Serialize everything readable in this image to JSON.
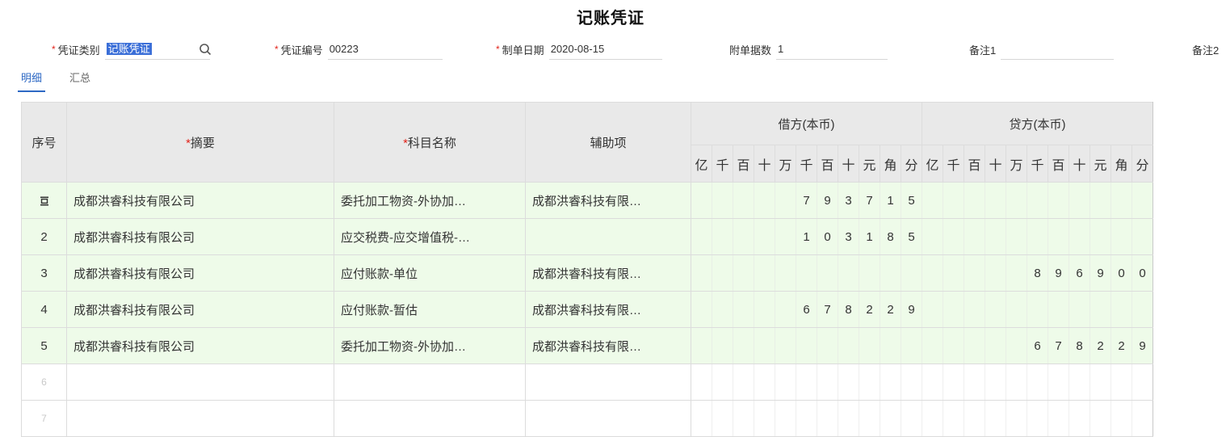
{
  "title": "记账凭证",
  "form": {
    "voucher_type": {
      "label": "凭证类别",
      "value": "记账凭证"
    },
    "voucher_no": {
      "label": "凭证编号",
      "value": "00223"
    },
    "date": {
      "label": "制单日期",
      "value": "2020-08-15"
    },
    "attachments": {
      "label": "附单据数",
      "value": "1"
    },
    "remark1": {
      "label": "备注1",
      "value": ""
    },
    "remark2": {
      "label": "备注2"
    }
  },
  "tabs": [
    {
      "label": "明细",
      "active": true
    },
    {
      "label": "汇总",
      "active": false
    }
  ],
  "table": {
    "headers": {
      "seq": "序号",
      "summary": "摘要",
      "account": "科目名称",
      "aux": "辅助项",
      "debit": "借方(本币)",
      "credit": "贷方(本币)"
    },
    "debit_digits": [
      "亿",
      "千",
      "百",
      "十",
      "万",
      "千",
      "百",
      "十",
      "元",
      "角",
      "分"
    ],
    "credit_digits": [
      "亿",
      "千",
      "百",
      "十",
      "万",
      "千",
      "百",
      "十",
      "元",
      "角",
      "分"
    ],
    "rows": [
      {
        "seq": "",
        "summary": "成都洪睿科技有限公司",
        "account": "委托加工物资-外协加…",
        "aux": "成都洪睿科技有限…",
        "debit": [
          "",
          "",
          "",
          "",
          "",
          "7",
          "9",
          "3",
          "7",
          "1",
          "5"
        ],
        "credit": [
          "",
          "",
          "",
          "",
          "",
          "",
          "",
          "",
          "",
          "",
          ""
        ]
      },
      {
        "seq": "2",
        "summary": "成都洪睿科技有限公司",
        "account": "应交税费-应交增值税-…",
        "aux": "",
        "debit": [
          "",
          "",
          "",
          "",
          "",
          "1",
          "0",
          "3",
          "1",
          "8",
          "5"
        ],
        "credit": [
          "",
          "",
          "",
          "",
          "",
          "",
          "",
          "",
          "",
          "",
          ""
        ]
      },
      {
        "seq": "3",
        "summary": "成都洪睿科技有限公司",
        "account": "应付账款-单位",
        "aux": "成都洪睿科技有限…",
        "debit": [
          "",
          "",
          "",
          "",
          "",
          "",
          "",
          "",
          "",
          "",
          ""
        ],
        "credit": [
          "",
          "",
          "",
          "",
          "",
          "8",
          "9",
          "6",
          "9",
          "0",
          "0"
        ]
      },
      {
        "seq": "4",
        "summary": "成都洪睿科技有限公司",
        "account": "应付账款-暂估",
        "aux": "成都洪睿科技有限…",
        "debit": [
          "",
          "",
          "",
          "",
          "",
          "6",
          "7",
          "8",
          "2",
          "2",
          "9"
        ],
        "credit": [
          "",
          "",
          "",
          "",
          "",
          "",
          "",
          "",
          "",
          "",
          ""
        ]
      },
      {
        "seq": "5",
        "summary": "成都洪睿科技有限公司",
        "account": "委托加工物资-外协加…",
        "aux": "成都洪睿科技有限…",
        "debit": [
          "",
          "",
          "",
          "",
          "",
          "",
          "",
          "",
          "",
          "",
          ""
        ],
        "credit": [
          "",
          "",
          "",
          "",
          "",
          "6",
          "7",
          "8",
          "2",
          "2",
          "9"
        ]
      },
      {
        "seq": "6",
        "summary": "",
        "account": "",
        "aux": "",
        "debit": [
          "",
          "",
          "",
          "",
          "",
          "",
          "",
          "",
          "",
          "",
          ""
        ],
        "credit": [
          "",
          "",
          "",
          "",
          "",
          "",
          "",
          "",
          "",
          "",
          ""
        ]
      },
      {
        "seq": "7",
        "summary": "",
        "account": "",
        "aux": "",
        "debit": [
          "",
          "",
          "",
          "",
          "",
          "",
          "",
          "",
          "",
          "",
          ""
        ],
        "credit": [
          "",
          "",
          "",
          "",
          "",
          "",
          "",
          "",
          "",
          "",
          ""
        ]
      }
    ],
    "filled_row_count": 5,
    "active_row_icon": "insert-row-icon"
  },
  "colors": {
    "accent": "#2d68c4",
    "required": "#e2231a",
    "filled_row_bg": "#eefbe9",
    "header_bg": "#e9e9e9",
    "selection_bg": "#3b6fd8"
  }
}
